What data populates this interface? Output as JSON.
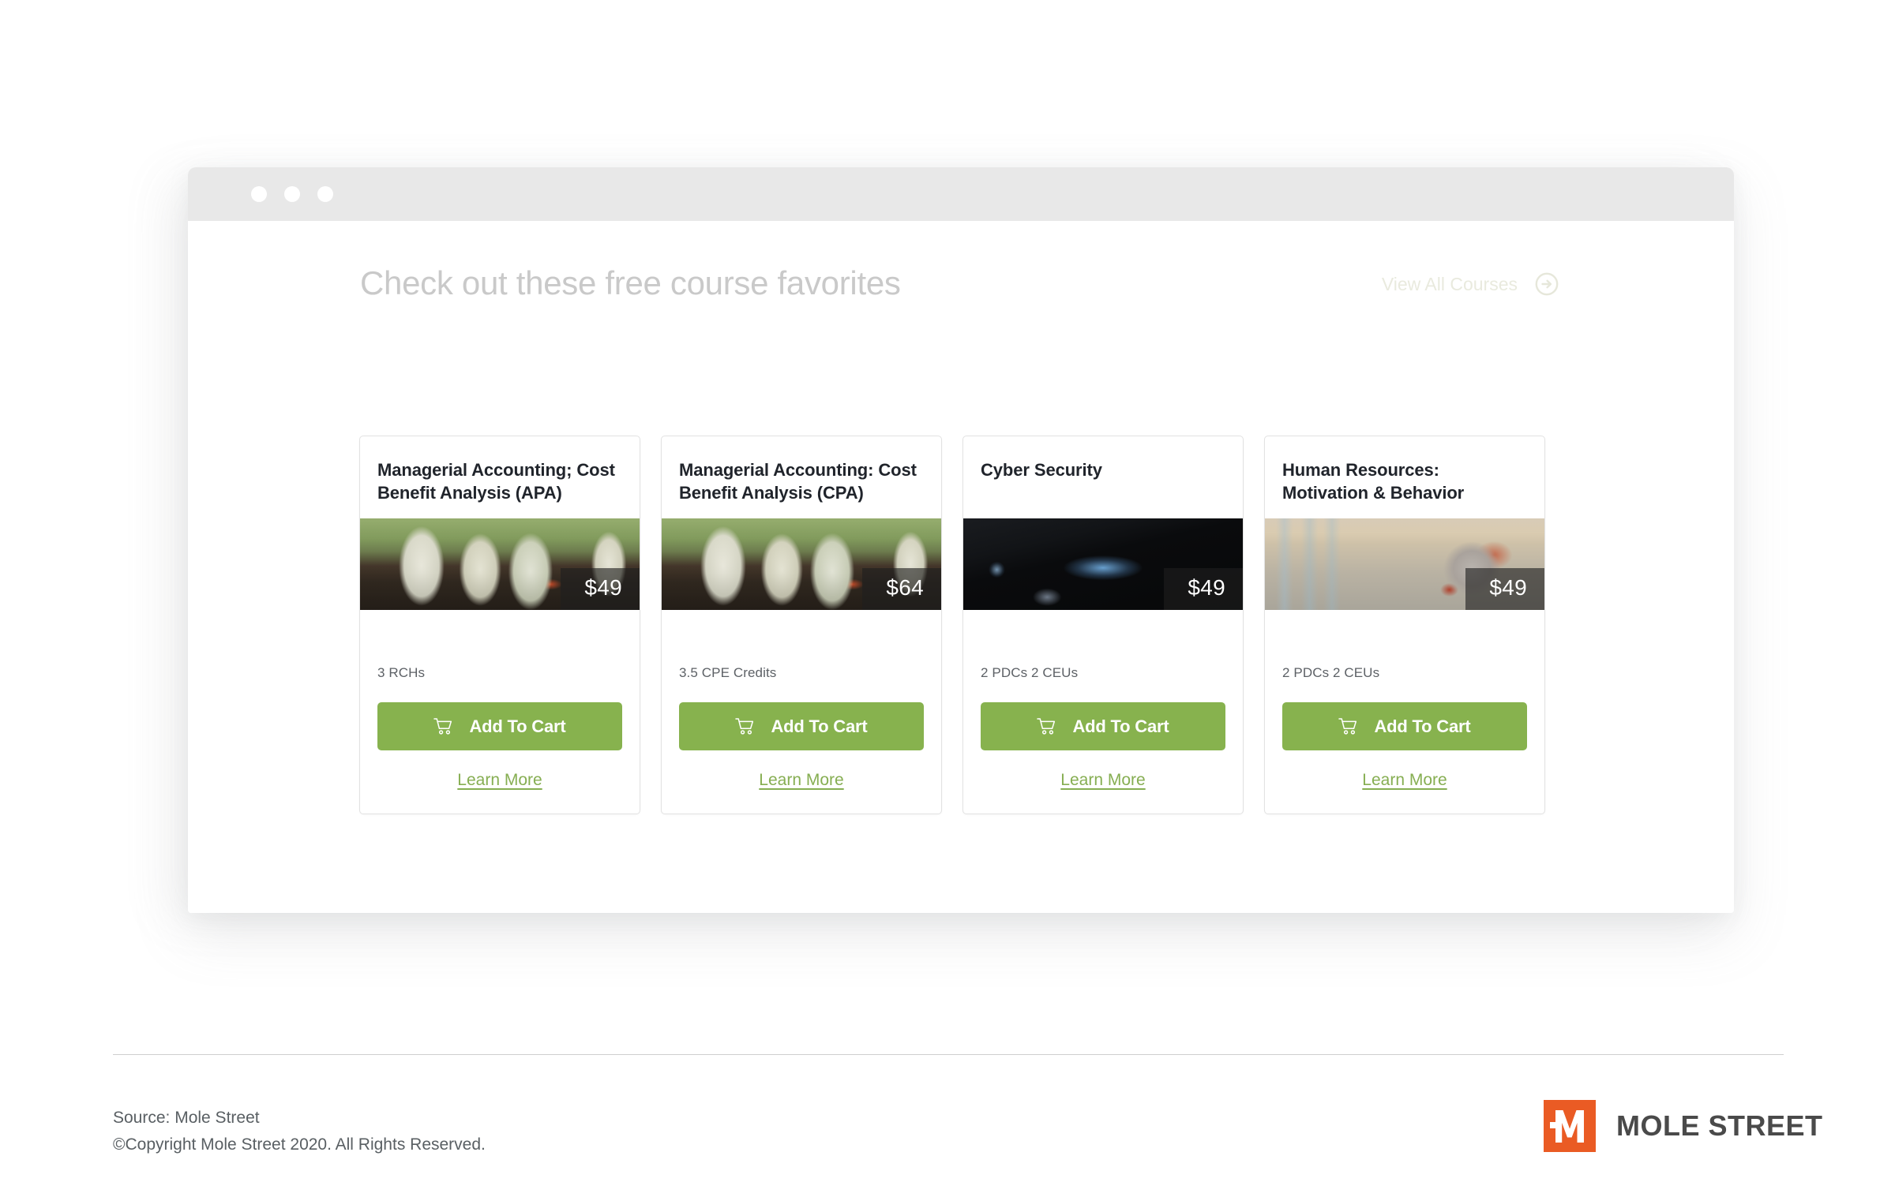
{
  "browser": {
    "window_dots": [
      "dot-1",
      "dot-2",
      "dot-3"
    ]
  },
  "section": {
    "title": "Check out these free course favorites",
    "view_all_label": "View All Courses",
    "view_all_icon": "arrow-circle-right-icon"
  },
  "cards": [
    {
      "title": "Managerial Accounting; Cost Benefit Analysis (APA)",
      "price": "$49",
      "credits": "3 RCHs",
      "cart_label": "Add To Cart",
      "cart_icon": "shopping-cart-icon",
      "learn_more": "Learn More",
      "image_alt": "money-planted-in-soil-photo"
    },
    {
      "title": "Managerial Accounting: Cost Benefit Analysis (CPA)",
      "price": "$64",
      "credits": "3.5 CPE Credits",
      "cart_label": "Add To Cart",
      "cart_icon": "shopping-cart-icon",
      "learn_more": "Learn More",
      "image_alt": "money-planted-in-soil-photo"
    },
    {
      "title": "Cyber Security",
      "price": "$49",
      "credits": "2 PDCs  2 CEUs",
      "cart_label": "Add To Cart",
      "cart_icon": "shopping-cart-icon",
      "learn_more": "Learn More",
      "image_alt": "security-screen-photo"
    },
    {
      "title": "Human Resources: Motivation & Behavior",
      "price": "$49",
      "credits": "2 PDCs  2 CEUs",
      "cart_label": "Add To Cart",
      "cart_icon": "shopping-cart-icon",
      "learn_more": "Learn More",
      "image_alt": "anatomical-skull-in-lobby-photo"
    }
  ],
  "footer": {
    "source": "Source: Mole Street",
    "copyright": "©Copyright Mole Street 2020. All Rights Reserved.",
    "logo_wordmark": "MOLE STREET",
    "logo_letter": "M"
  },
  "colors": {
    "accent_green": "#87b24e",
    "link_green": "#86ae52",
    "logo_orange": "#ea5b24",
    "heading_gray": "#c9c9c9",
    "title_dark": "#20242b"
  }
}
